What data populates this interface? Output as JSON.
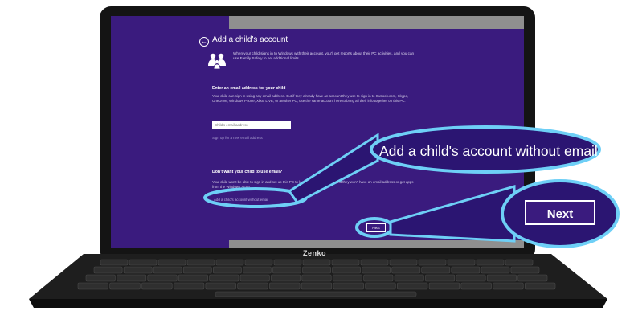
{
  "window": {
    "title": "Add a child's account",
    "intro": "When your child signs in to Windows with their account, you'll get reports about their PC activities, and you can use Family Safety to set additional limits.",
    "email_section_heading": "Enter an email address for your child",
    "email_section_text": "Your child can sign in using any email address. But if they already have an account they use to sign in to Outlook.com, Skype, OneDrive, Windows Phone, Xbox LIVE, or another PC, use the same account here to bring all their info together on this PC.",
    "email_placeholder": "Child's email address",
    "signup_link": "Sign up for a new email address",
    "no_email_heading": "Don't want your child to use email?",
    "no_email_text": "Your child won't be able to sign in and set up this PC to look the way they want, but they won't have an email address or get apps from the Windows Store.",
    "no_email_link": "Add a child's account without email",
    "next_label": "Next",
    "cancel_label": "Cancel"
  },
  "laptop": {
    "brand": "Zenko"
  },
  "callouts": {
    "no_email_callout": "Add a child's account without email",
    "next_callout": "Next"
  },
  "colors": {
    "screen_bg": "#3a1b7e",
    "callout_ring": "#6ecff6",
    "callout_fill": "#2b1572"
  }
}
